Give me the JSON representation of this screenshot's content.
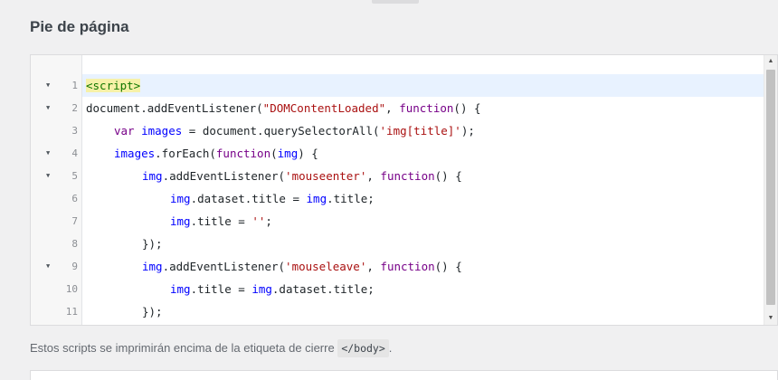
{
  "section": {
    "title": "Pie de página"
  },
  "editor": {
    "fold_icon": "▼",
    "scroll_up_icon": "▲",
    "scroll_down_icon": "▼",
    "lines": [
      {
        "num": "1",
        "fold": true,
        "active": true,
        "indent": 0,
        "tokens": [
          {
            "t": "tag",
            "v": "<script>"
          }
        ]
      },
      {
        "num": "2",
        "fold": true,
        "indent": 0,
        "tokens": [
          {
            "t": "plain",
            "v": "document.addEventListener("
          },
          {
            "t": "str",
            "v": "\"DOMContentLoaded\""
          },
          {
            "t": "plain",
            "v": ", "
          },
          {
            "t": "kw",
            "v": "function"
          },
          {
            "t": "plain",
            "v": "() {"
          }
        ]
      },
      {
        "num": "3",
        "fold": false,
        "indent": 1,
        "tokens": [
          {
            "t": "kw",
            "v": "var "
          },
          {
            "t": "var",
            "v": "images"
          },
          {
            "t": "plain",
            "v": " = document.querySelectorAll("
          },
          {
            "t": "str",
            "v": "'img[title]'"
          },
          {
            "t": "plain",
            "v": ");"
          }
        ]
      },
      {
        "num": "4",
        "fold": true,
        "indent": 1,
        "tokens": [
          {
            "t": "var",
            "v": "images"
          },
          {
            "t": "plain",
            "v": ".forEach("
          },
          {
            "t": "kw",
            "v": "function"
          },
          {
            "t": "plain",
            "v": "("
          },
          {
            "t": "var",
            "v": "img"
          },
          {
            "t": "plain",
            "v": ") {"
          }
        ]
      },
      {
        "num": "5",
        "fold": true,
        "indent": 2,
        "tokens": [
          {
            "t": "var",
            "v": "img"
          },
          {
            "t": "plain",
            "v": ".addEventListener("
          },
          {
            "t": "str",
            "v": "'mouseenter'"
          },
          {
            "t": "plain",
            "v": ", "
          },
          {
            "t": "kw",
            "v": "function"
          },
          {
            "t": "plain",
            "v": "() {"
          }
        ]
      },
      {
        "num": "6",
        "fold": false,
        "indent": 3,
        "tokens": [
          {
            "t": "var",
            "v": "img"
          },
          {
            "t": "plain",
            "v": ".dataset.title = "
          },
          {
            "t": "var",
            "v": "img"
          },
          {
            "t": "plain",
            "v": ".title;"
          }
        ]
      },
      {
        "num": "7",
        "fold": false,
        "indent": 3,
        "tokens": [
          {
            "t": "var",
            "v": "img"
          },
          {
            "t": "plain",
            "v": ".title = "
          },
          {
            "t": "str",
            "v": "''"
          },
          {
            "t": "plain",
            "v": ";"
          }
        ]
      },
      {
        "num": "8",
        "fold": false,
        "indent": 2,
        "tokens": [
          {
            "t": "plain",
            "v": "});"
          }
        ]
      },
      {
        "num": "9",
        "fold": true,
        "indent": 2,
        "tokens": [
          {
            "t": "var",
            "v": "img"
          },
          {
            "t": "plain",
            "v": ".addEventListener("
          },
          {
            "t": "str",
            "v": "'mouseleave'"
          },
          {
            "t": "plain",
            "v": ", "
          },
          {
            "t": "kw",
            "v": "function"
          },
          {
            "t": "plain",
            "v": "() {"
          }
        ]
      },
      {
        "num": "10",
        "fold": false,
        "indent": 3,
        "tokens": [
          {
            "t": "var",
            "v": "img"
          },
          {
            "t": "plain",
            "v": ".title = "
          },
          {
            "t": "var",
            "v": "img"
          },
          {
            "t": "plain",
            "v": ".dataset.title;"
          }
        ]
      },
      {
        "num": "11",
        "fold": false,
        "indent": 2,
        "tokens": [
          {
            "t": "plain",
            "v": "});"
          }
        ]
      }
    ]
  },
  "description": {
    "text": "Estos scripts se imprimirán encima de la etiqueta de cierre ",
    "code": "</body>",
    "suffix": "."
  }
}
